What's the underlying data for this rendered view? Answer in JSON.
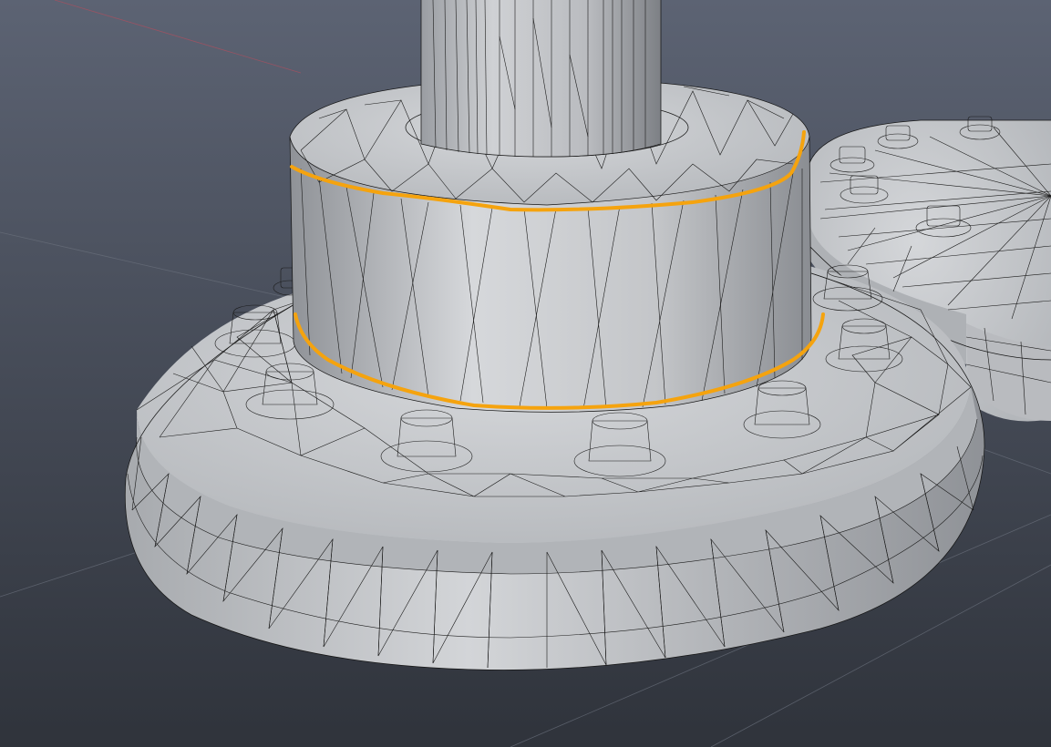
{
  "viewport": {
    "background_top": "#5b6272",
    "background_bottom": "#30343d",
    "grid_line_color": "#6a707c",
    "x_axis_color": "#a85060"
  },
  "mesh": {
    "surface_color": "#c9cbce",
    "surface_shadow": "#8c8f94",
    "wire_color": "#161616"
  },
  "annotations": {
    "stroke_color": "#f5a30e",
    "count": 2
  }
}
